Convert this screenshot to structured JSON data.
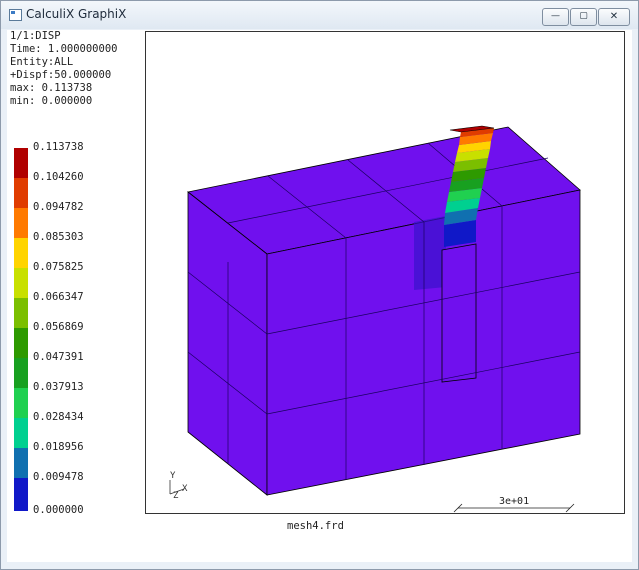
{
  "window": {
    "title": "CalculiX GraphiX",
    "controls": {
      "minimize": "—",
      "maximize": "▢",
      "close": "✕"
    }
  },
  "info": {
    "lines": [
      "1/1:DISP",
      "Time: 1.000000000",
      "Entity:ALL",
      "+Dispf:50.000000",
      "max: 0.113738",
      "min: 0.000000"
    ]
  },
  "legend": {
    "labels": [
      "0.113738",
      "0.104260",
      "0.094782",
      "0.085303",
      "0.075825",
      "0.066347",
      "0.056869",
      "0.047391",
      "0.037913",
      "0.028434",
      "0.018956",
      "0.009478",
      "0.000000"
    ],
    "colors": [
      "#b00000",
      "#e03c00",
      "#ff7a00",
      "#ffd400",
      "#c8e000",
      "#7bbf00",
      "#2e9a00",
      "#18a020",
      "#20d050",
      "#00d090",
      "#1070b0",
      "#1018c8",
      "#7a10f0"
    ]
  },
  "viewport": {
    "axis_labels": {
      "y": "Y",
      "z": "Z",
      "x": "X"
    },
    "scale_label": "3e+01",
    "mesh_color": "#7010ee"
  },
  "footer": {
    "filename": "mesh4.frd"
  }
}
